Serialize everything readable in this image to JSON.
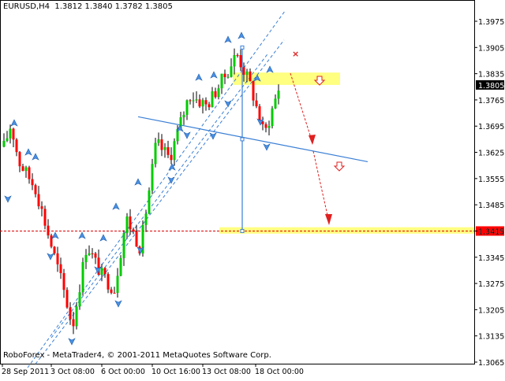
{
  "header": {
    "title": "EURUSD,H4  1.3812 1.3840 1.3782 1.3805"
  },
  "footer": {
    "copyright": "RoboForex - MetaTrader4, © 2001-2011 MetaQuotes Software Corp."
  },
  "chart_data": {
    "type": "candlestick",
    "symbol": "EURUSD",
    "timeframe": "H4",
    "last_bar": {
      "open": 1.3812,
      "high": 1.384,
      "low": 1.3782,
      "close": 1.3805
    },
    "ylim": [
      1.3065,
      1.3975
    ],
    "y_ticks": [
      "1.3975",
      "1.3905",
      "1.3835",
      "1.3765",
      "1.3695",
      "1.3625",
      "1.3555",
      "1.3485",
      "1.3415",
      "1.3345",
      "1.3275",
      "1.3205",
      "1.3135",
      "1.3065"
    ],
    "x_ticks": [
      "28 Sep 2011",
      "3 Oct 08:00",
      "6 Oct 00:00",
      "10 Oct 16:00",
      "13 Oct 08:00",
      "18 Oct 00:00"
    ],
    "current_price_label": "1.3805",
    "target_price_label": "1.3415",
    "bullish_color": "#00cc00",
    "bearish_color": "#ff0000",
    "channel_color": "#3a7fd5",
    "target_zone_color": "#ffff80",
    "arrow_color": "#e02020"
  }
}
